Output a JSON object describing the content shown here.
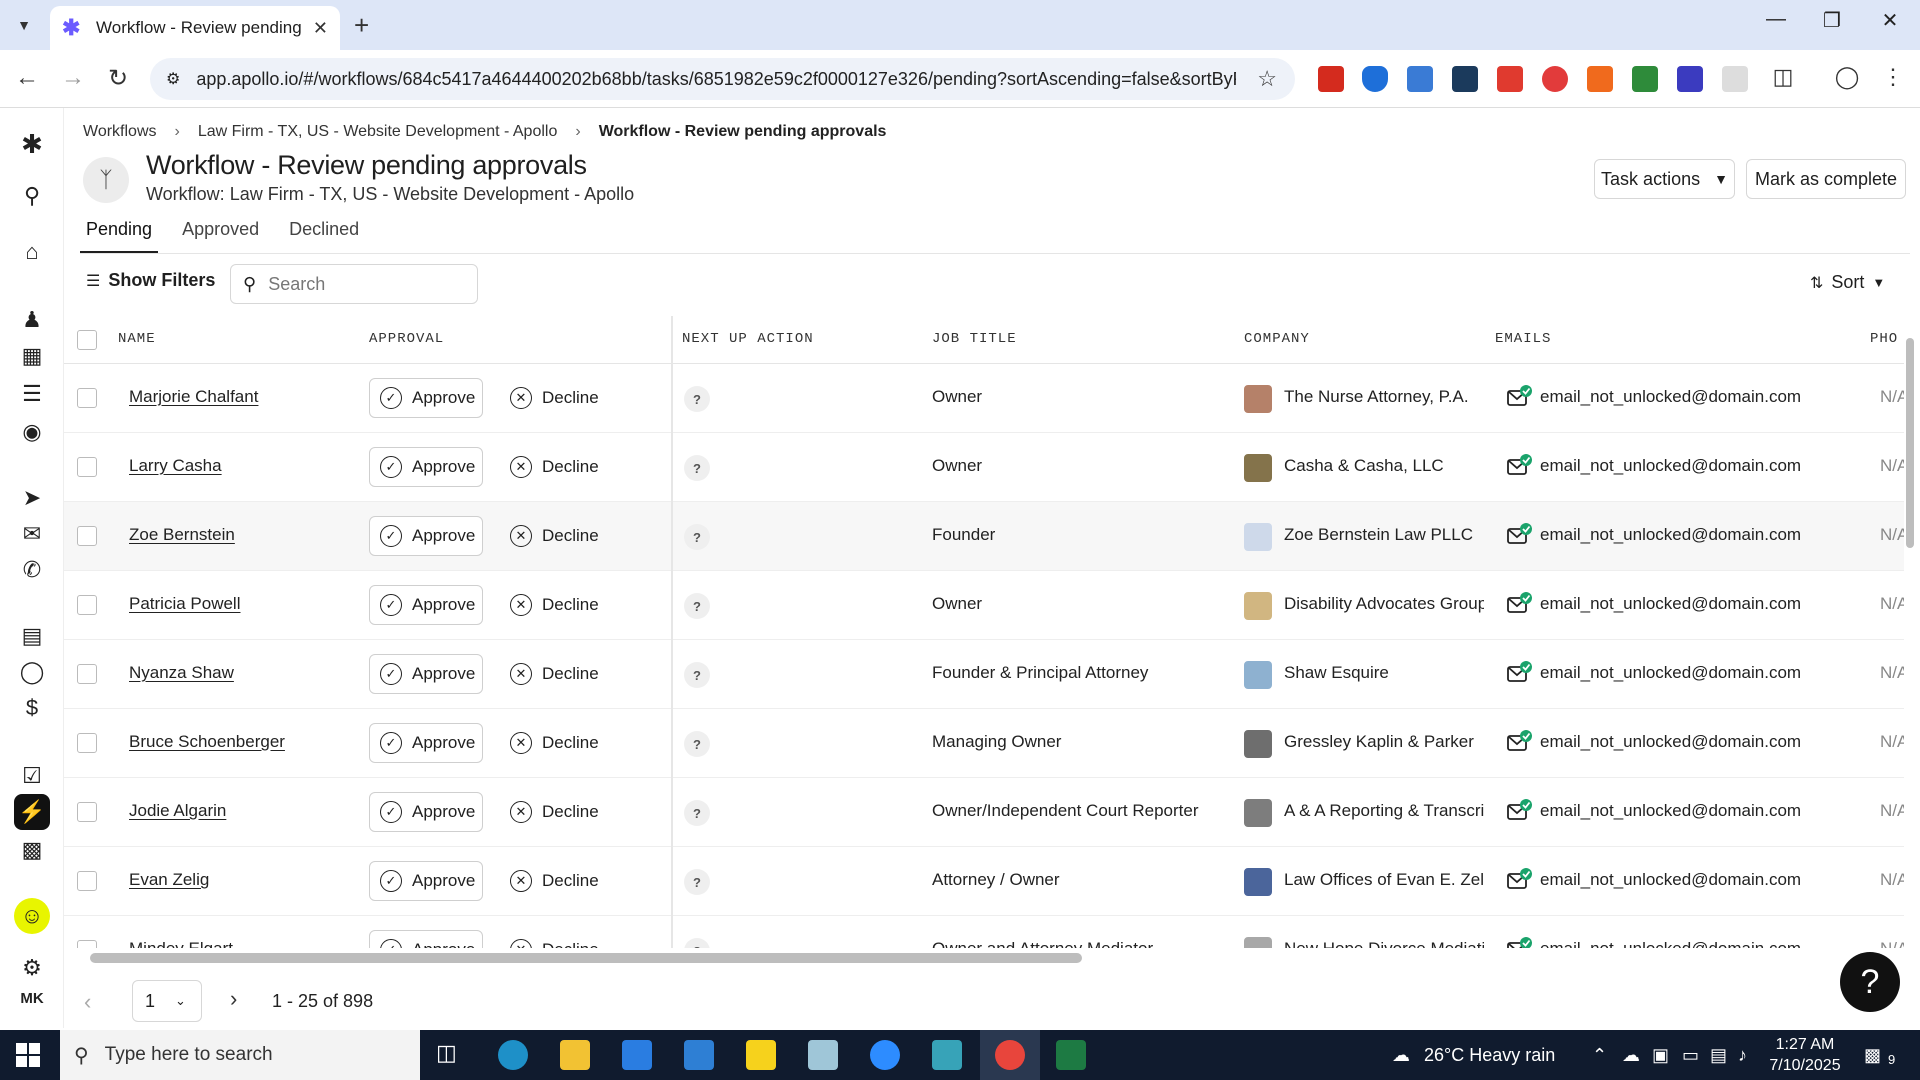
{
  "browser": {
    "tab_title": "Workflow - Review pending approvals",
    "url": "app.apollo.io/#/workflows/684c5417a4644400202b68bb/tasks/6851982e59c2f0000127e326/pending?sortAscending=false&sortByFie..."
  },
  "breadcrumb": {
    "root": "Workflows",
    "parent": "Law Firm - TX, US - Website Development - Apollo",
    "current": "Workflow - Review pending approvals"
  },
  "header": {
    "title": "Workflow - Review pending approvals",
    "workflow_label": "Workflow:",
    "workflow_name": "Law Firm - TX, US - Website Development - Apollo",
    "task_actions": "Task actions",
    "mark_complete": "Mark as complete"
  },
  "tabs": [
    {
      "label": "Pending",
      "active": true
    },
    {
      "label": "Approved",
      "active": false
    },
    {
      "label": "Declined",
      "active": false
    }
  ],
  "toolbar": {
    "show_filters": "Show Filters",
    "search_placeholder": "Search",
    "sort": "Sort"
  },
  "table": {
    "columns": {
      "name": "NAME",
      "approval": "APPROVAL",
      "next_up": "NEXT UP ACTION",
      "job_title": "JOB TITLE",
      "company": "COMPANY",
      "emails": "EMAILS",
      "phone": "PHO"
    },
    "approve_label": "Approve",
    "decline_label": "Decline",
    "next_up_value": "?",
    "rows": [
      {
        "name": "Marjorie Chalfant",
        "job": "Owner",
        "company": "The Nurse Attorney, P.A.",
        "email": "email_not_unlocked@domain.com",
        "phone": "N/A"
      },
      {
        "name": "Larry Casha",
        "job": "Owner",
        "company": "Casha & Casha, LLC",
        "email": "email_not_unlocked@domain.com",
        "phone": "N/A"
      },
      {
        "name": "Zoe Bernstein",
        "job": "Founder",
        "company": "Zoe Bernstein Law PLLC",
        "email": "email_not_unlocked@domain.com",
        "phone": "N/A"
      },
      {
        "name": "Patricia Powell",
        "job": "Owner",
        "company": "Disability Advocates Group",
        "email": "email_not_unlocked@domain.com",
        "phone": "N/A"
      },
      {
        "name": "Nyanza Shaw",
        "job": "Founder & Principal Attorney",
        "company": "Shaw Esquire",
        "email": "email_not_unlocked@domain.com",
        "phone": "N/A"
      },
      {
        "name": "Bruce Schoenberger",
        "job": "Managing Owner",
        "company": "Gressley Kaplin & Parker",
        "email": "email_not_unlocked@domain.com",
        "phone": "N/A"
      },
      {
        "name": "Jodie Algarin",
        "job": "Owner/Independent Court Reporter",
        "company": "A & A Reporting & Transcription",
        "email": "email_not_unlocked@domain.com",
        "phone": "N/A"
      },
      {
        "name": "Evan Zelig",
        "job": "Attorney / Owner",
        "company": "Law Offices of Evan E. Zelig",
        "email": "email_not_unlocked@domain.com",
        "phone": "N/A"
      },
      {
        "name": "Mindey Elgart",
        "job": "Owner and Attorney Mediator",
        "company": "New Hope Divorce Mediation",
        "email": "email_not_unlocked@domain.com",
        "phone": "N/A"
      }
    ]
  },
  "pagination": {
    "page": "1",
    "range": "1 - 25 of 898"
  },
  "user": {
    "initials": "MK"
  },
  "taskbar": {
    "search_placeholder": "Type here to search",
    "weather": "26°C  Heavy rain",
    "time": "1:27 AM",
    "date": "7/10/2025",
    "notifications": "9"
  },
  "colors": {
    "accent": "#1f1f1f",
    "approved_mail": "#1aa36b",
    "taskbar": "#101b2e"
  }
}
